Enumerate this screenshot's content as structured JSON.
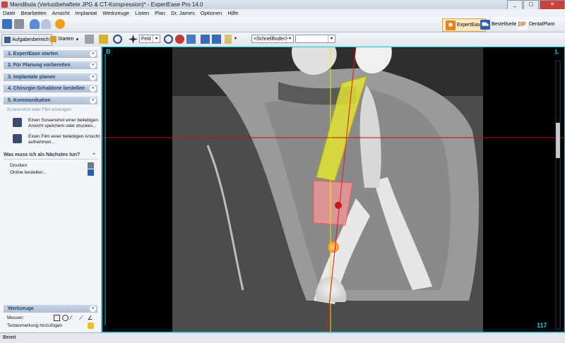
{
  "window": {
    "title": "Mandibula (Verlustbehaftete JPG & CT-Kompression)* - ExpertEase Pro  14.0"
  },
  "menu": [
    "Datei",
    "Bearbeiten",
    "Ansicht",
    "Implantat",
    "Werkzeuge",
    "Listen",
    "Plan",
    "Dr. James",
    "Optionen",
    "Hilfe"
  ],
  "toolbar_top": {
    "modules": [
      "ExpertEase",
      "Bestellseiten",
      "DentalPlant"
    ]
  },
  "toolbar": {
    "taskpane_label": "Aufgabenbereich",
    "start_label": "Starten",
    "view_combo": "Feld",
    "finder_combo": "<Schnellfinder>",
    "extra_combo": ""
  },
  "sidebar": {
    "steps": [
      {
        "label": "1. ExpertEase starten"
      },
      {
        "label": "2. Für Planung vorbereiten"
      },
      {
        "label": "3. Implantate planen"
      },
      {
        "label": "4. Chirurgie-Schablone bestellen"
      },
      {
        "label": "5. Kommunikation"
      }
    ],
    "sub_heading": "Screenshot oder Film erzeugen",
    "actions": [
      {
        "label": "Einen Screenshot einer beliebigen Ansicht speichern oder drucken..."
      },
      {
        "label": "Einen Film einer beliebigen Ansicht aufnehmen..."
      }
    ],
    "next": {
      "title": "Was muss ich als Nächstes tun?",
      "items": [
        {
          "label": "Drucken"
        },
        {
          "label": "Online bestellen..."
        }
      ]
    },
    "tools": {
      "title": "Werkzeuge",
      "measure_label": "Messen",
      "annotate_label": "Textanmerkung hinzufügen"
    }
  },
  "viewer": {
    "corner_left": "B",
    "corner_right": "L",
    "slice_number": "117",
    "accent_color": "#00d0e0"
  },
  "status": {
    "text": "Bereit"
  }
}
